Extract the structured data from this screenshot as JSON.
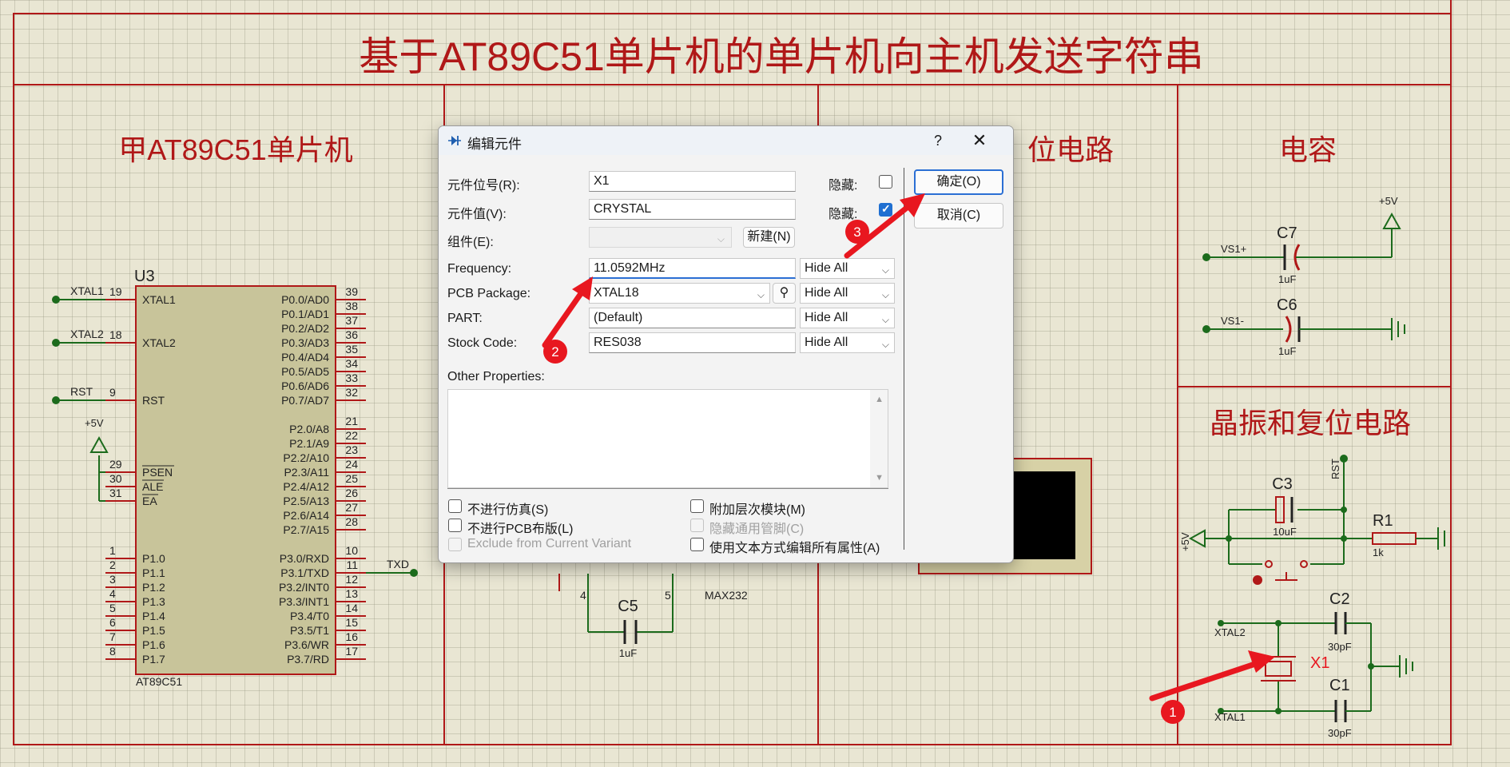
{
  "schematic": {
    "title": "基于AT89C51单片机的单片机向主机发送字符串",
    "sections": {
      "mcu": "甲AT89C51单片机",
      "partial_right": "位电路",
      "capacitor": "电容",
      "crystal_reset": "晶振和复位电路"
    },
    "mcu": {
      "ref": "U3",
      "part": "AT89C51",
      "left_pins": [
        {
          "num": "19",
          "name": "XTAL1",
          "net": "XTAL1"
        },
        {
          "num": "18",
          "name": "XTAL2",
          "net": "XTAL2"
        },
        {
          "num": "9",
          "name": "RST",
          "net": "RST"
        },
        {
          "num": "29",
          "name": "PSEN",
          "net": ""
        },
        {
          "num": "30",
          "name": "ALE",
          "net": ""
        },
        {
          "num": "31",
          "name": "EA",
          "net": ""
        },
        {
          "num": "1",
          "name": "P1.0",
          "net": ""
        },
        {
          "num": "2",
          "name": "P1.1",
          "net": ""
        },
        {
          "num": "3",
          "name": "P1.2",
          "net": ""
        },
        {
          "num": "4",
          "name": "P1.3",
          "net": ""
        },
        {
          "num": "5",
          "name": "P1.4",
          "net": ""
        },
        {
          "num": "6",
          "name": "P1.5",
          "net": ""
        },
        {
          "num": "7",
          "name": "P1.6",
          "net": ""
        },
        {
          "num": "8",
          "name": "P1.7",
          "net": ""
        }
      ],
      "right_pins": [
        {
          "num": "39",
          "name": "P0.0/AD0"
        },
        {
          "num": "38",
          "name": "P0.1/AD1"
        },
        {
          "num": "37",
          "name": "P0.2/AD2"
        },
        {
          "num": "36",
          "name": "P0.3/AD3"
        },
        {
          "num": "35",
          "name": "P0.4/AD4"
        },
        {
          "num": "34",
          "name": "P0.5/AD5"
        },
        {
          "num": "33",
          "name": "P0.6/AD6"
        },
        {
          "num": "32",
          "name": "P0.7/AD7"
        },
        {
          "num": "21",
          "name": "P2.0/A8"
        },
        {
          "num": "22",
          "name": "P2.1/A9"
        },
        {
          "num": "23",
          "name": "P2.2/A10"
        },
        {
          "num": "24",
          "name": "P2.3/A11"
        },
        {
          "num": "25",
          "name": "P2.4/A12"
        },
        {
          "num": "26",
          "name": "P2.5/A13"
        },
        {
          "num": "27",
          "name": "P2.6/A14"
        },
        {
          "num": "28",
          "name": "P2.7/A15"
        },
        {
          "num": "10",
          "name": "P3.0/RXD"
        },
        {
          "num": "11",
          "name": "P3.1/TXD"
        },
        {
          "num": "12",
          "name": "P3.2/INT0"
        },
        {
          "num": "13",
          "name": "P3.3/INT1"
        },
        {
          "num": "14",
          "name": "P3.4/T0"
        },
        {
          "num": "15",
          "name": "P3.5/T1"
        },
        {
          "num": "16",
          "name": "P3.6/WR"
        },
        {
          "num": "17",
          "name": "P3.7/RD"
        }
      ],
      "vcc_label": "+5V",
      "txd_net": "TXD"
    },
    "max232": {
      "part": "MAX232",
      "cap": "C5",
      "cap_val": "1uF",
      "pin4": "4",
      "pin5": "5"
    },
    "caps": {
      "c7": "C7",
      "c7_val": "1uF",
      "c7_net": "VS1+",
      "c6": "C6",
      "c6_val": "1uF",
      "c6_net": "VS1-",
      "vcc": "+5V"
    },
    "crystal": {
      "c3": "C3",
      "c3_val": "10uF",
      "r1": "R1",
      "r1_val": "1k",
      "rst": "RST",
      "vcc": "+5V",
      "c2": "C2",
      "c2_val": "30pF",
      "c1": "C1",
      "c1_val": "30pF",
      "x1": "X1",
      "xtal2": "XTAL2",
      "xtal1": "XTAL1"
    },
    "annotation_badges": [
      "1",
      "2",
      "3"
    ]
  },
  "dialog": {
    "title": "编辑元件",
    "help": "?",
    "close": "✕",
    "fields": {
      "ref_label": "元件位号(R):",
      "ref_value": "X1",
      "value_label": "元件值(V):",
      "value_value": "CRYSTAL",
      "group_label": "组件(E):",
      "group_value": "",
      "new_button": "新建(N)",
      "hide_label": "隐藏:",
      "ref_hidden": false,
      "value_hidden": true
    },
    "props": [
      {
        "label": "Frequency:",
        "value": "11.0592MHz",
        "vis": "Hide All",
        "kind": "text"
      },
      {
        "label": "PCB Package:",
        "value": "XTAL18",
        "vis": "Hide All",
        "kind": "combo"
      },
      {
        "label": "PART:",
        "value": "(Default)",
        "vis": "Hide All",
        "kind": "text"
      },
      {
        "label": "Stock Code:",
        "value": "RES038",
        "vis": "Hide All",
        "kind": "text"
      }
    ],
    "other_label": "Other Properties:",
    "ok": "确定(O)",
    "cancel": "取消(C)",
    "checkboxes_left": [
      {
        "label": "不进行仿真(S)",
        "checked": false,
        "disabled": false
      },
      {
        "label": "不进行PCB布版(L)",
        "checked": false,
        "disabled": false
      },
      {
        "label": "Exclude from Current Variant",
        "checked": false,
        "disabled": true
      }
    ],
    "checkboxes_right": [
      {
        "label": "附加层次模块(M)",
        "checked": false,
        "disabled": false
      },
      {
        "label": "隐藏通用管脚(C)",
        "checked": false,
        "disabled": true
      },
      {
        "label": "使用文本方式编辑所有属性(A)",
        "checked": false,
        "disabled": false
      }
    ]
  },
  "colors": {
    "frame": "#b01818",
    "wire": "#1c6b1c",
    "chip": "#c8c49a",
    "label_red": "#b01818",
    "accent": "#2b6fd4",
    "badge": "#e8171f"
  }
}
